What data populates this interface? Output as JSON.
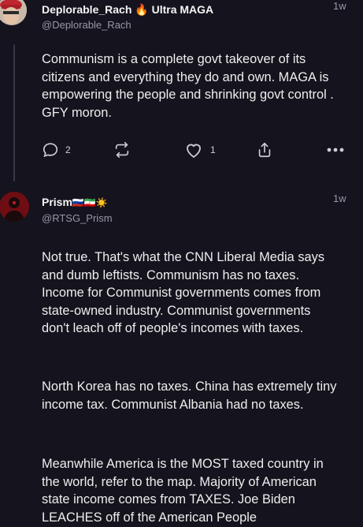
{
  "post1": {
    "display_name": "Deplorable_Rach",
    "name_suffix": "Ultra MAGA",
    "handle": "@Deplorable_Rach",
    "time": "1w",
    "text": "Communism is a complete govt takeover of its citizens and everything they do and own. MAGA is empowering the people and shrinking govt control . GFY moron.",
    "reply_count": "2",
    "like_count": "1"
  },
  "post2": {
    "display_name": "Prism",
    "name_flags": "🇷🇺🇮🇷☀️",
    "handle": "@RTSG_Prism",
    "time": "1w",
    "paragraphs": [
      "Not true. That's what the CNN Liberal Media says and dumb leftists. Communism has no taxes. Income for Communist governments comes from state-owned industry. Communist governments don't leach off of people's incomes with taxes.",
      "North Korea has no taxes. China has extremely tiny income tax. Communist Albania had no taxes.",
      "Meanwhile America is the MOST taxed country in the world, refer to the map. Majority of American state income comes from TAXES. Joe Biden LEACHES off of the American People"
    ]
  }
}
